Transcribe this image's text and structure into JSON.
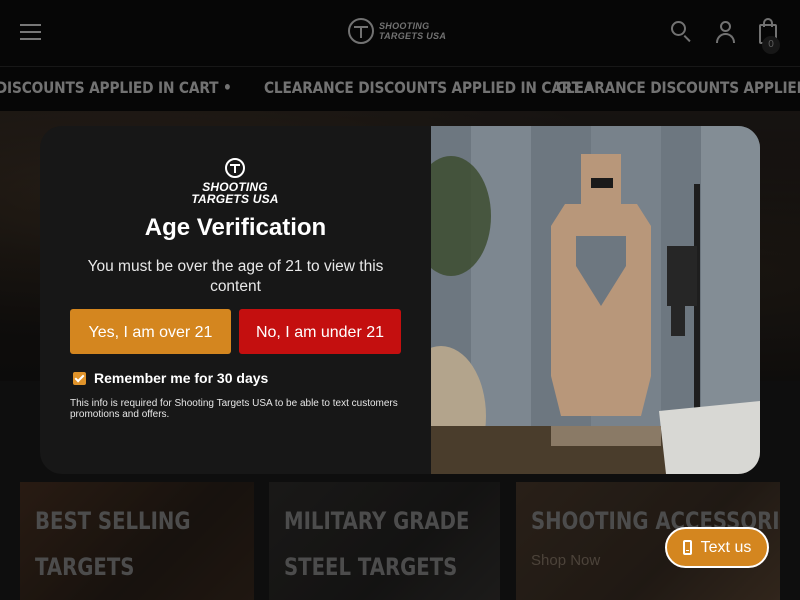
{
  "header": {
    "logo_text": "SHOOTING TARGETS USA",
    "cart_count": "0",
    "icons": [
      "hamburger-menu-icon",
      "search-icon",
      "user-icon",
      "cart-icon"
    ]
  },
  "marquee": {
    "items": [
      "CE DISCOUNTS APPLIED IN CART •",
      "CLEARANCE DISCOUNTS APPLIED IN CART •",
      "CLEARANCE DISCOUNTS APPLIED IN CART •"
    ]
  },
  "cards": [
    {
      "title_line1": "BEST SELLING",
      "title_line2": "TARGETS"
    },
    {
      "title_line1": "MILITARY GRADE",
      "title_line2": "STEEL TARGETS"
    },
    {
      "title_line1": "SHOOTING ACCESSORIES",
      "link": "Shop Now"
    }
  ],
  "modal": {
    "logo_text_line1": "SHOOTING",
    "logo_text_line2": "TARGETS USA",
    "title": "Age Verification",
    "message": "You must be over the age of 21 to view this content",
    "yes_label": "Yes, I am over 21",
    "no_label": "No, I am under 21",
    "remember_label": "Remember me for 30 days",
    "remember_checked": true,
    "fineprint": "This info is required for Shooting Targets USA to be able to text customers promotions and offers."
  },
  "textus": {
    "label": "Text us"
  },
  "colors": {
    "accent_orange": "#d4861f",
    "decline_red": "#c40f0f",
    "modal_bg": "#171717",
    "header_bg": "#0b0b0b"
  }
}
